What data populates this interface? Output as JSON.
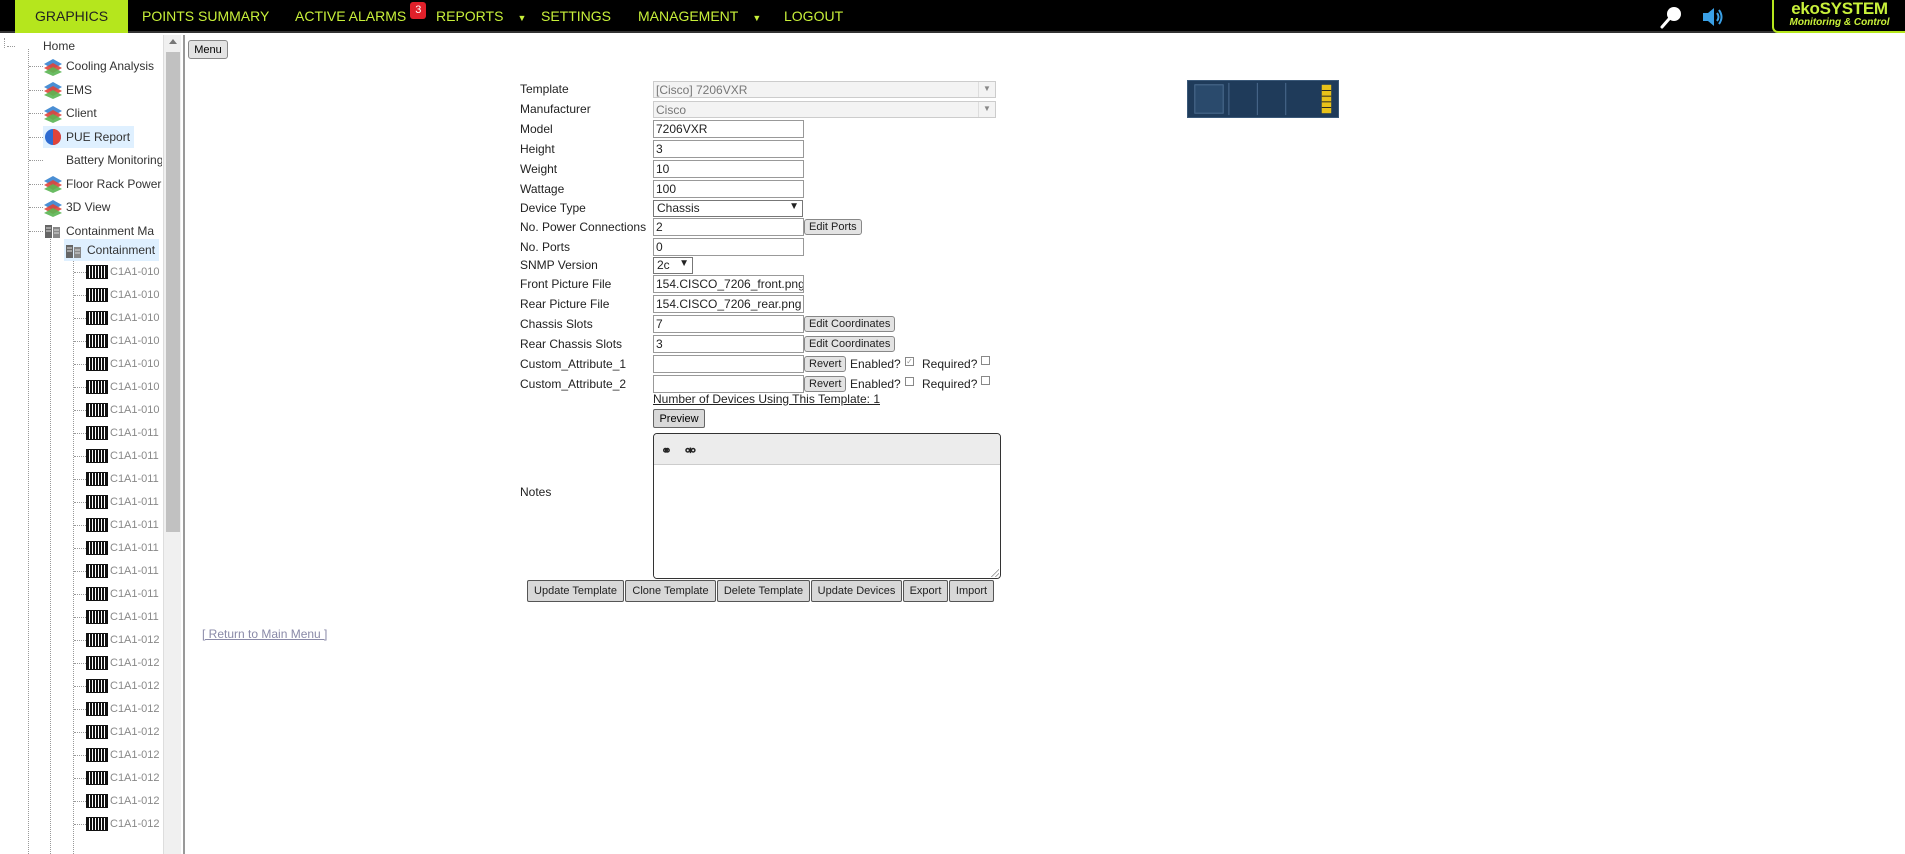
{
  "nav": {
    "items": [
      {
        "label": "GRAPHICS"
      },
      {
        "label": "POINTS SUMMARY"
      },
      {
        "label": "ACTIVE ALARMS",
        "badge": "3"
      },
      {
        "label": "REPORTS"
      },
      {
        "label": "SETTINGS"
      },
      {
        "label": "MANAGEMENT"
      },
      {
        "label": "LOGOUT"
      }
    ],
    "brand_line1": "ekoSYSTEM",
    "brand_line2": "Monitoring & Control",
    "accent_color": "#b5e61d",
    "icons": [
      "search-icon",
      "speaker-icon"
    ]
  },
  "sidebar": {
    "root": "Home",
    "items": [
      {
        "label": "Cooling Analysis",
        "icon": "layers-icon"
      },
      {
        "label": "EMS",
        "icon": "layers-icon"
      },
      {
        "label": "Client",
        "icon": "layers-icon"
      },
      {
        "label": "PUE Report",
        "icon": "pie-icon"
      },
      {
        "label": "Battery Monitoring",
        "icon": ""
      },
      {
        "label": "Floor Rack Power",
        "icon": "layers-icon"
      },
      {
        "label": "3D View",
        "icon": "layers-icon"
      },
      {
        "label": "Containment Ma",
        "icon": "servers-icon"
      }
    ],
    "selected": "Containment",
    "devices": [
      "C1A1-010",
      "C1A1-010",
      "C1A1-010",
      "C1A1-010",
      "C1A1-010",
      "C1A1-010",
      "C1A1-010",
      "C1A1-011",
      "C1A1-011",
      "C1A1-011",
      "C1A1-011",
      "C1A1-011",
      "C1A1-011",
      "C1A1-011",
      "C1A1-011",
      "C1A1-011",
      "C1A1-012",
      "C1A1-012",
      "C1A1-012",
      "C1A1-012",
      "C1A1-012",
      "C1A1-012",
      "C1A1-012",
      "C1A1-012",
      "C1A1-012"
    ]
  },
  "menu_button": "Menu",
  "form": {
    "labels": {
      "template": "Template",
      "manufacturer": "Manufacturer",
      "model": "Model",
      "height": "Height",
      "weight": "Weight",
      "wattage": "Wattage",
      "device_type": "Device Type",
      "power_connections": "No. Power Connections",
      "ports": "No. Ports",
      "snmp": "SNMP Version",
      "front_pic": "Front Picture File",
      "rear_pic": "Rear Picture File",
      "chassis_slots": "Chassis Slots",
      "rear_chassis_slots": "Rear Chassis Slots",
      "custom1": "Custom_Attribute_1",
      "custom2": "Custom_Attribute_2",
      "notes": "Notes"
    },
    "values": {
      "template": "[Cisco] 7206VXR",
      "manufacturer": "Cisco",
      "model": "7206VXR",
      "height": "3",
      "weight": "10",
      "wattage": "100",
      "device_type": "Chassis",
      "power_connections": "2",
      "ports": "0",
      "snmp": "2c",
      "front_pic": "154.CISCO_7206_front.png",
      "rear_pic": "154.CISCO_7206_rear.png",
      "chassis_slots": "7",
      "rear_chassis_slots": "3",
      "custom1": "",
      "custom2": ""
    },
    "buttons": {
      "edit_ports": "Edit Ports",
      "edit_coordinates": "Edit Coordinates",
      "revert": "Revert",
      "preview": "Preview"
    },
    "enabled_label": "Enabled?",
    "required_label": "Required?",
    "custom1_enabled": true,
    "custom1_required": false,
    "custom2_enabled": false,
    "custom2_required": false,
    "usage_text": "Number of Devices Using This Template: 1"
  },
  "actions": [
    "Update Template",
    "Clone Template",
    "Delete Template",
    "Update Devices",
    "Export",
    "Import"
  ],
  "return_link": "[ Return to Main Menu ]"
}
